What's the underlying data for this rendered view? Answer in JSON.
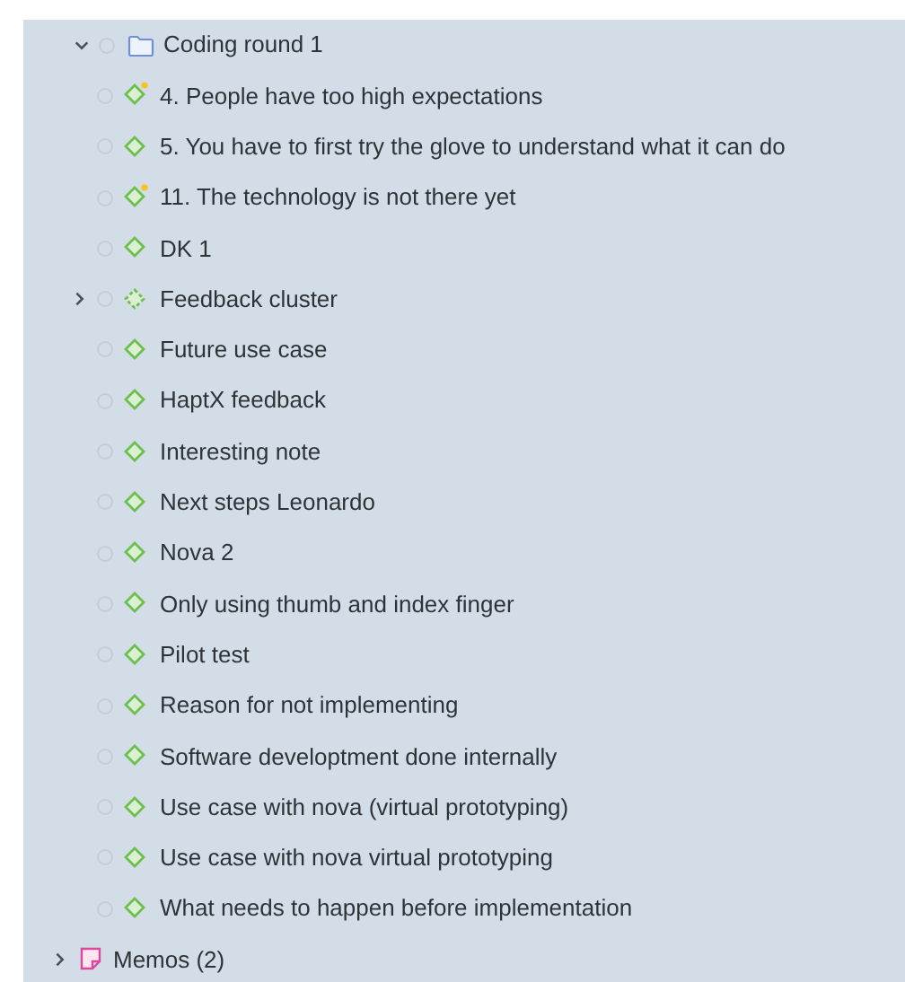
{
  "tree": [
    {
      "kind": "folder",
      "label": "Coding round 1",
      "expanded": true,
      "children": [
        {
          "kind": "code",
          "label": "4. People have too high expectations",
          "flagged": true
        },
        {
          "kind": "code",
          "label": "5. You have to first try the glove to understand what it can do",
          "flagged": false
        },
        {
          "kind": "code",
          "label": "11. The technology is not there yet",
          "flagged": true
        },
        {
          "kind": "code",
          "label": "DK 1",
          "flagged": false
        },
        {
          "kind": "cluster",
          "label": "Feedback cluster",
          "flagged": false,
          "expanded": false
        },
        {
          "kind": "code",
          "label": "Future use case",
          "flagged": false
        },
        {
          "kind": "code",
          "label": "HaptX feedback",
          "flagged": false
        },
        {
          "kind": "code",
          "label": "Interesting note",
          "flagged": false
        },
        {
          "kind": "code",
          "label": "Next steps Leonardo",
          "flagged": false
        },
        {
          "kind": "code",
          "label": "Nova 2",
          "flagged": false
        },
        {
          "kind": "code",
          "label": "Only using thumb and index finger",
          "flagged": false
        },
        {
          "kind": "code",
          "label": "Pilot test",
          "flagged": false
        },
        {
          "kind": "code",
          "label": "Reason for not implementing",
          "flagged": false
        },
        {
          "kind": "code",
          "label": "Software developtment done internally",
          "flagged": false
        },
        {
          "kind": "code",
          "label": "Use case with nova (virtual prototyping)",
          "flagged": false
        },
        {
          "kind": "code",
          "label": "Use case with nova virtual prototyping",
          "flagged": false
        },
        {
          "kind": "code",
          "label": "What needs to happen before implementation",
          "flagged": false
        }
      ]
    },
    {
      "kind": "memos",
      "label": "Memos (2)",
      "expanded": false
    }
  ]
}
